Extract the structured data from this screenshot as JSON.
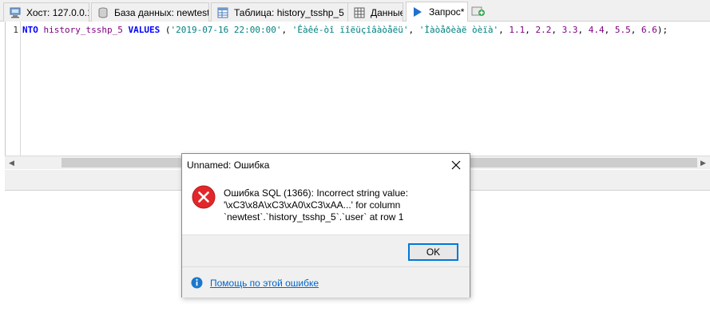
{
  "tabs": [
    {
      "label": "Хост: 127.0.0.1",
      "icon": "server-icon"
    },
    {
      "label": "База данных: newtest",
      "icon": "database-icon"
    },
    {
      "label": "Таблица: history_tsshp_5",
      "icon": "table-icon"
    },
    {
      "label": "Данные",
      "icon": "data-grid-icon"
    },
    {
      "label": "Запрос*",
      "icon": "play-icon",
      "active": true
    }
  ],
  "new_tab_icon": "new-query-tab-icon",
  "editor": {
    "line_number": "1",
    "tokens": [
      {
        "t": "NTO ",
        "c": "kw"
      },
      {
        "t": "history_tsshp_5 ",
        "c": "ident"
      },
      {
        "t": "VALUES ",
        "c": "kw"
      },
      {
        "t": "(",
        "c": "plain"
      },
      {
        "t": "'2019-07-16 22:00:00'",
        "c": "str"
      },
      {
        "t": ", ",
        "c": "plain"
      },
      {
        "t": "'Êàêé-òî ïîëüçîâàòåëü'",
        "c": "str"
      },
      {
        "t": ", ",
        "c": "plain"
      },
      {
        "t": "'Ìàòåðèàë òèïà'",
        "c": "str"
      },
      {
        "t": ", ",
        "c": "plain"
      },
      {
        "t": "1.1",
        "c": "num"
      },
      {
        "t": ", ",
        "c": "plain"
      },
      {
        "t": "2.2",
        "c": "num"
      },
      {
        "t": ", ",
        "c": "plain"
      },
      {
        "t": "3.3",
        "c": "num"
      },
      {
        "t": ", ",
        "c": "plain"
      },
      {
        "t": "4.4",
        "c": "num"
      },
      {
        "t": ", ",
        "c": "plain"
      },
      {
        "t": "5.5",
        "c": "num"
      },
      {
        "t": ", ",
        "c": "plain"
      },
      {
        "t": "6.6",
        "c": "num"
      },
      {
        "t": ");",
        "c": "plain"
      }
    ]
  },
  "scrollbar": {
    "left_arrow": "◀",
    "right_arrow": "▶"
  },
  "dialog": {
    "title": "Unnamed: Ошибка",
    "message_lines": [
      "Ошибка SQL (1366): Incorrect string value:",
      "'\\xC3\\x8A\\xC3\\xA0\\xC3\\xAA...' for column",
      "`newtest`.`history_tsshp_5`.`user` at row 1"
    ],
    "ok_label": "OK",
    "help_link": "Помощь по этой ошибке"
  },
  "colors": {
    "keyword": "#0000ff",
    "identifier": "#800080",
    "string": "#008080",
    "error_red": "#e2262a",
    "info_blue": "#1b77cc",
    "link": "#0066cc",
    "focus_border": "#0078d7"
  }
}
